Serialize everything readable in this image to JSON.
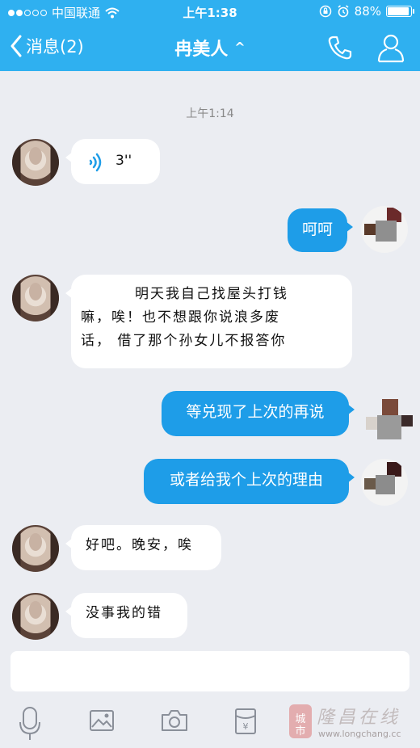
{
  "status_bar": {
    "carrier": "中国联通",
    "time": "上午1:38",
    "battery_text": "88%",
    "battery_level": 0.88
  },
  "nav": {
    "back_label": "消息(2)",
    "title": "冉美人",
    "title_caret": "^"
  },
  "chat": {
    "timestamp": "上午1:14",
    "messages": [
      {
        "side": "in",
        "type": "voice",
        "duration": "3''"
      },
      {
        "side": "out",
        "text": "呵呵"
      },
      {
        "side": "in",
        "lines": [
          "明天我自己找屋头打钱",
          "嘛，唉！也不想跟你说浪多废",
          "话， 借了那个孙女儿不报答你"
        ]
      },
      {
        "side": "out",
        "text": "等兑现了上次的再说"
      },
      {
        "side": "out",
        "text": "或者给我个上次的理由"
      },
      {
        "side": "in",
        "text": "好吧。晚安，唉"
      },
      {
        "side": "in",
        "text": "没事我的错"
      }
    ]
  },
  "input": {
    "placeholder": ""
  },
  "toolbar": {
    "icons": [
      "microphone-icon",
      "image-icon",
      "camera-icon",
      "red-packet-icon"
    ]
  },
  "watermark": {
    "seal_text": "城市",
    "text": "隆昌在线",
    "url": "www.longchang.cc"
  },
  "colors": {
    "header": "#2fb0f0",
    "outgoing_bubble": "#1e9de8",
    "incoming_bubble": "#ffffff",
    "background": "#ebedf2"
  }
}
